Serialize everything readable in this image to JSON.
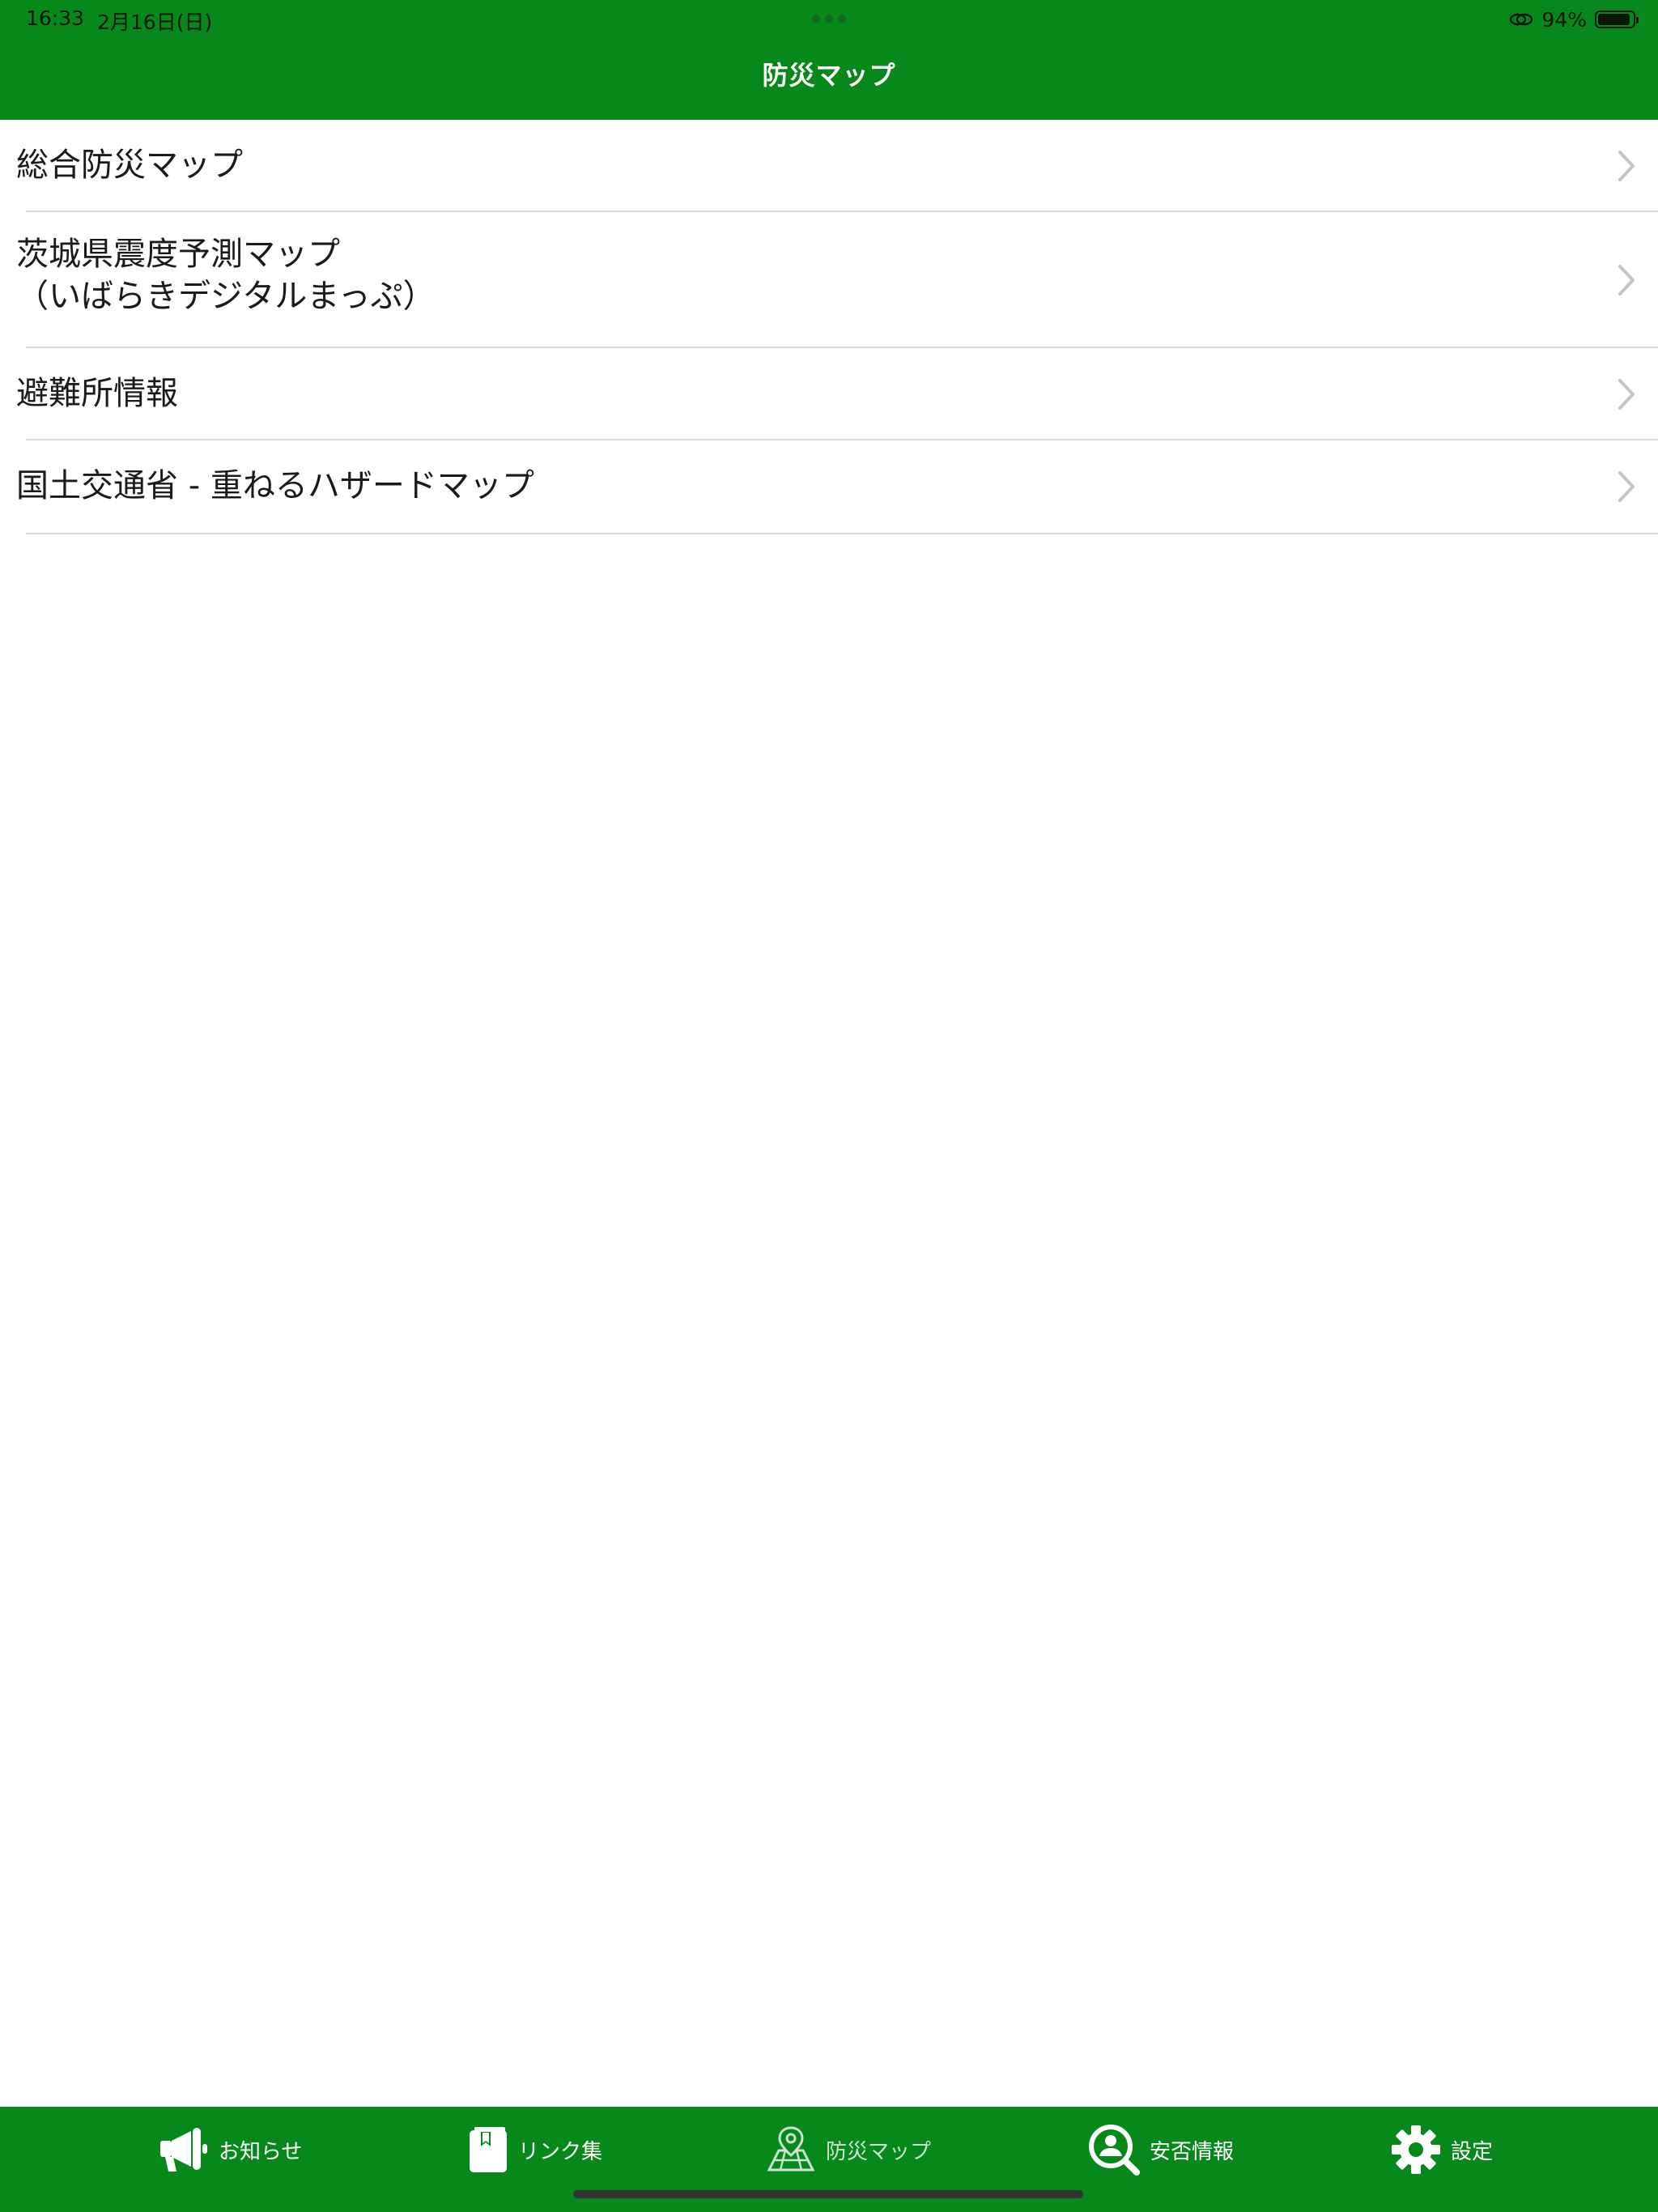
{
  "status_bar": {
    "time": "16:33",
    "date": "2月16日(日)",
    "battery": "94%",
    "battery_level": 0.94
  },
  "nav": {
    "title": "防災マップ"
  },
  "list": {
    "items": [
      {
        "label": "総合防災マップ"
      },
      {
        "label": "茨城県震度予測マップ\n（いばらきデジタルまっぷ）"
      },
      {
        "label": "避難所情報"
      },
      {
        "label": "国土交通省 - 重ねるハザードマップ"
      }
    ]
  },
  "tabs": [
    {
      "label": "お知らせ",
      "icon": "megaphone-icon"
    },
    {
      "label": "リンク集",
      "icon": "bookmark-book-icon"
    },
    {
      "label": "防災マップ",
      "icon": "map-pin-icon",
      "active": true
    },
    {
      "label": "安否情報",
      "icon": "person-search-icon"
    },
    {
      "label": "設定",
      "icon": "gear-icon"
    }
  ],
  "colors": {
    "brand_green": "#07881a",
    "divider": "#d9d9d9",
    "chevron": "#c4c4c4"
  }
}
